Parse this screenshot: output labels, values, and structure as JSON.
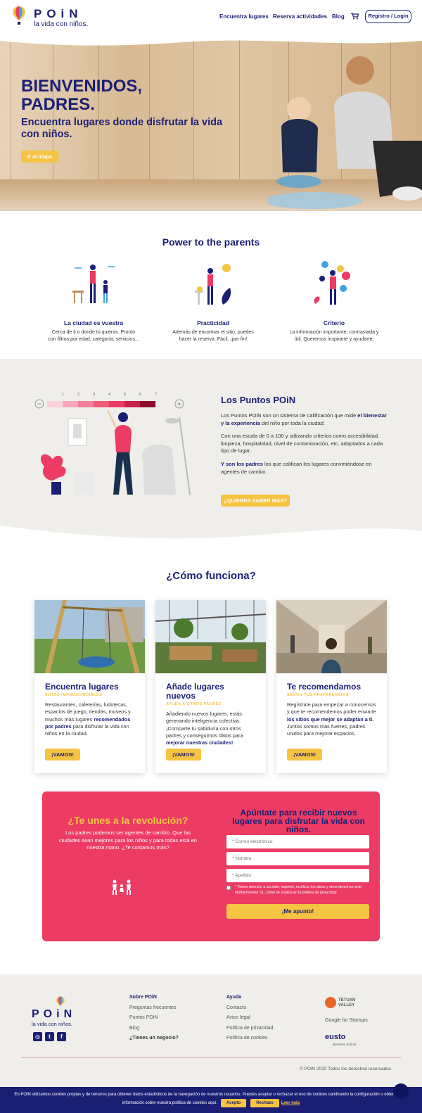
{
  "brand": {
    "name": "POiN",
    "tagline": "la vida con niños."
  },
  "nav": {
    "item1": "Encuentra lugares",
    "item2": "Reserva actividades",
    "item3": "Blog",
    "login": "Registro / Login"
  },
  "hero": {
    "title": "BIENVENIDOS, PADRES.",
    "subtitle": "Encuentra lugares donde disfrutar la vida con niños.",
    "button": "Ir al mapa"
  },
  "power": {
    "title": "Power to the parents",
    "features": [
      {
        "title": "La ciudad es vuestra",
        "text": "Cerca de ti o donde tú quieras. Pronto con filtros por edad, categoría, servicios..."
      },
      {
        "title": "Practicidad",
        "text": "Además de encontrar el sitio, puedes hacer la reserva. Fácil, ¡por fin!"
      },
      {
        "title": "Criterio",
        "text": "La información importante, contrastada y útil. Queremos inspirarte y ayudarte."
      }
    ]
  },
  "puntos": {
    "title": "Los Puntos POiN",
    "p1_a": "Los Puntos POiN son un sistema de calificación que mide ",
    "p1_b": "el bienestar y la experiencia",
    "p1_c": " del niño por toda la ciudad.",
    "p2": "Con una escala de 0 a 100 y utilizando criterios como accesibilidad, limpieza, hospitalidad, nivel de contaminación, etc. adaptados a cada tipo de lugar.",
    "p3_a": "Y son los padres",
    "p3_b": " los que califican los lugares convirtiéndose en agentes de cambio.",
    "button": "¿QUIERES SABER MÁS?",
    "scale": [
      "1",
      "2",
      "3",
      "4",
      "5",
      "6",
      "7"
    ]
  },
  "como": {
    "title": "¿Cómo funciona?",
    "cards": [
      {
        "title": "Encuentra lugares",
        "sub": "SITIOS IMPRESCINDIBLES",
        "text_a": "Restaurantes, cafeterías, ludotecas, espacios de juego, tiendas, museos y muchos más lugares ",
        "text_b": "recomendados por padres",
        "text_c": " para disfrutar la vida con niños en la ciudad.",
        "button": "¡VAMOS!"
      },
      {
        "title": "Añade lugares nuevos",
        "sub": "AYUDA A OTROS PADRES",
        "text_a": "Añadiendo nuevos lugares, estás generando inteligencia colectiva. ¡Comparte tu sabiduría con otros padres y conseguimos datos para ",
        "text_b": "mejorar nuestras ciudades!",
        "text_c": "",
        "button": "¡VAMOS!"
      },
      {
        "title": "Te recomendamos",
        "sub": "SEGÚN TUS PREFERENCIAS",
        "text_a": "Regístrate para empezar a conocernos y que te recomendemos poder enviarte ",
        "text_b": "los sitios que mejor se adaptan a ti.",
        "text_c": " Juntos somos más fuertes, padres unidos para mejorar espacios.",
        "button": "¡VAMOS!"
      }
    ]
  },
  "revo": {
    "title": "¿Te unes a la revolución?",
    "text": "Los padres podemos ser agentes de cambio. Que las ciudades sean mejores para los niños y para todas está en nuestra mano. ¿Te contamos más?",
    "form_title": "Apúntate para recibir nuevos lugares para disfrutar la vida con niños.",
    "email_ph": "* Correo electrónico",
    "name_ph": "* Nombre",
    "surname_ph": "* Apellido",
    "legal": "* Tienes derecho a acceder, suprimir, rectificar los datos y otros derechos ante Motherfounder SL, como se explica en la política de privacidad",
    "submit": "¡Me apunto!"
  },
  "footer": {
    "col1_title": "Sobre POiN",
    "col1": [
      "Preguntas frecuentes",
      "Puntos POiN",
      "Blog"
    ],
    "col1_bold": "¿Tienes un negocio?",
    "col2_title": "Ayuda",
    "col2": [
      "Contacto",
      "Aviso legal",
      "Política de privacidad",
      "Política de cookies"
    ],
    "partner1": "TETUAN VALLEY",
    "partner2": "Google for Startups",
    "partner3": "eusto",
    "partner3_sub": "Business School",
    "copyright": "© POiN 2020 Todos los derechos reservados"
  },
  "cookie": {
    "text": "En POiN utilizamos cookies propias y de terceros para obtener datos estadísticos de la navegación de nuestros usuarios. Puedes aceptar o rechazar el uso de cookies cambiando la configuración u obtener más información sobre nuestra política de cookies aquí.",
    "accept": "Acepto",
    "reject": "Rechazo",
    "more": "Leer más"
  },
  "colors": {
    "navy": "#1b1f74",
    "yellow": "#f6c443",
    "pink": "#ec3c64",
    "grey": "#efeeea"
  }
}
